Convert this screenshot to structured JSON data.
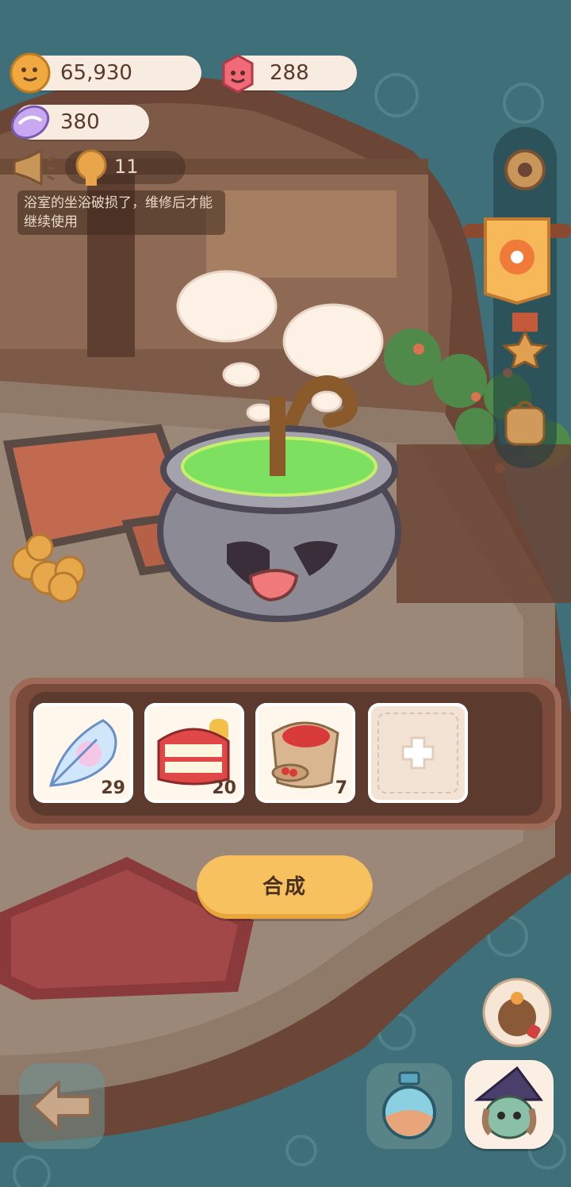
{
  "resources": {
    "coins": "65,930",
    "gems": "288",
    "crystals": "380"
  },
  "notice": {
    "cookie_count": "11",
    "message": "浴室的坐浴破损了，维修后才能继续使用"
  },
  "crafting": {
    "slots": [
      {
        "item": "feather-icon",
        "count": "29"
      },
      {
        "item": "teeth-icon",
        "count": "20"
      },
      {
        "item": "bean-sack-icon",
        "count": "7"
      },
      {
        "item": "add-slot-icon",
        "count": ""
      }
    ],
    "craft_label": "合成"
  },
  "colors": {
    "background": "#3f6f78",
    "craft_button": "#f7c160",
    "tray": "#7a4a3a",
    "pill": "#f8ebe0"
  }
}
